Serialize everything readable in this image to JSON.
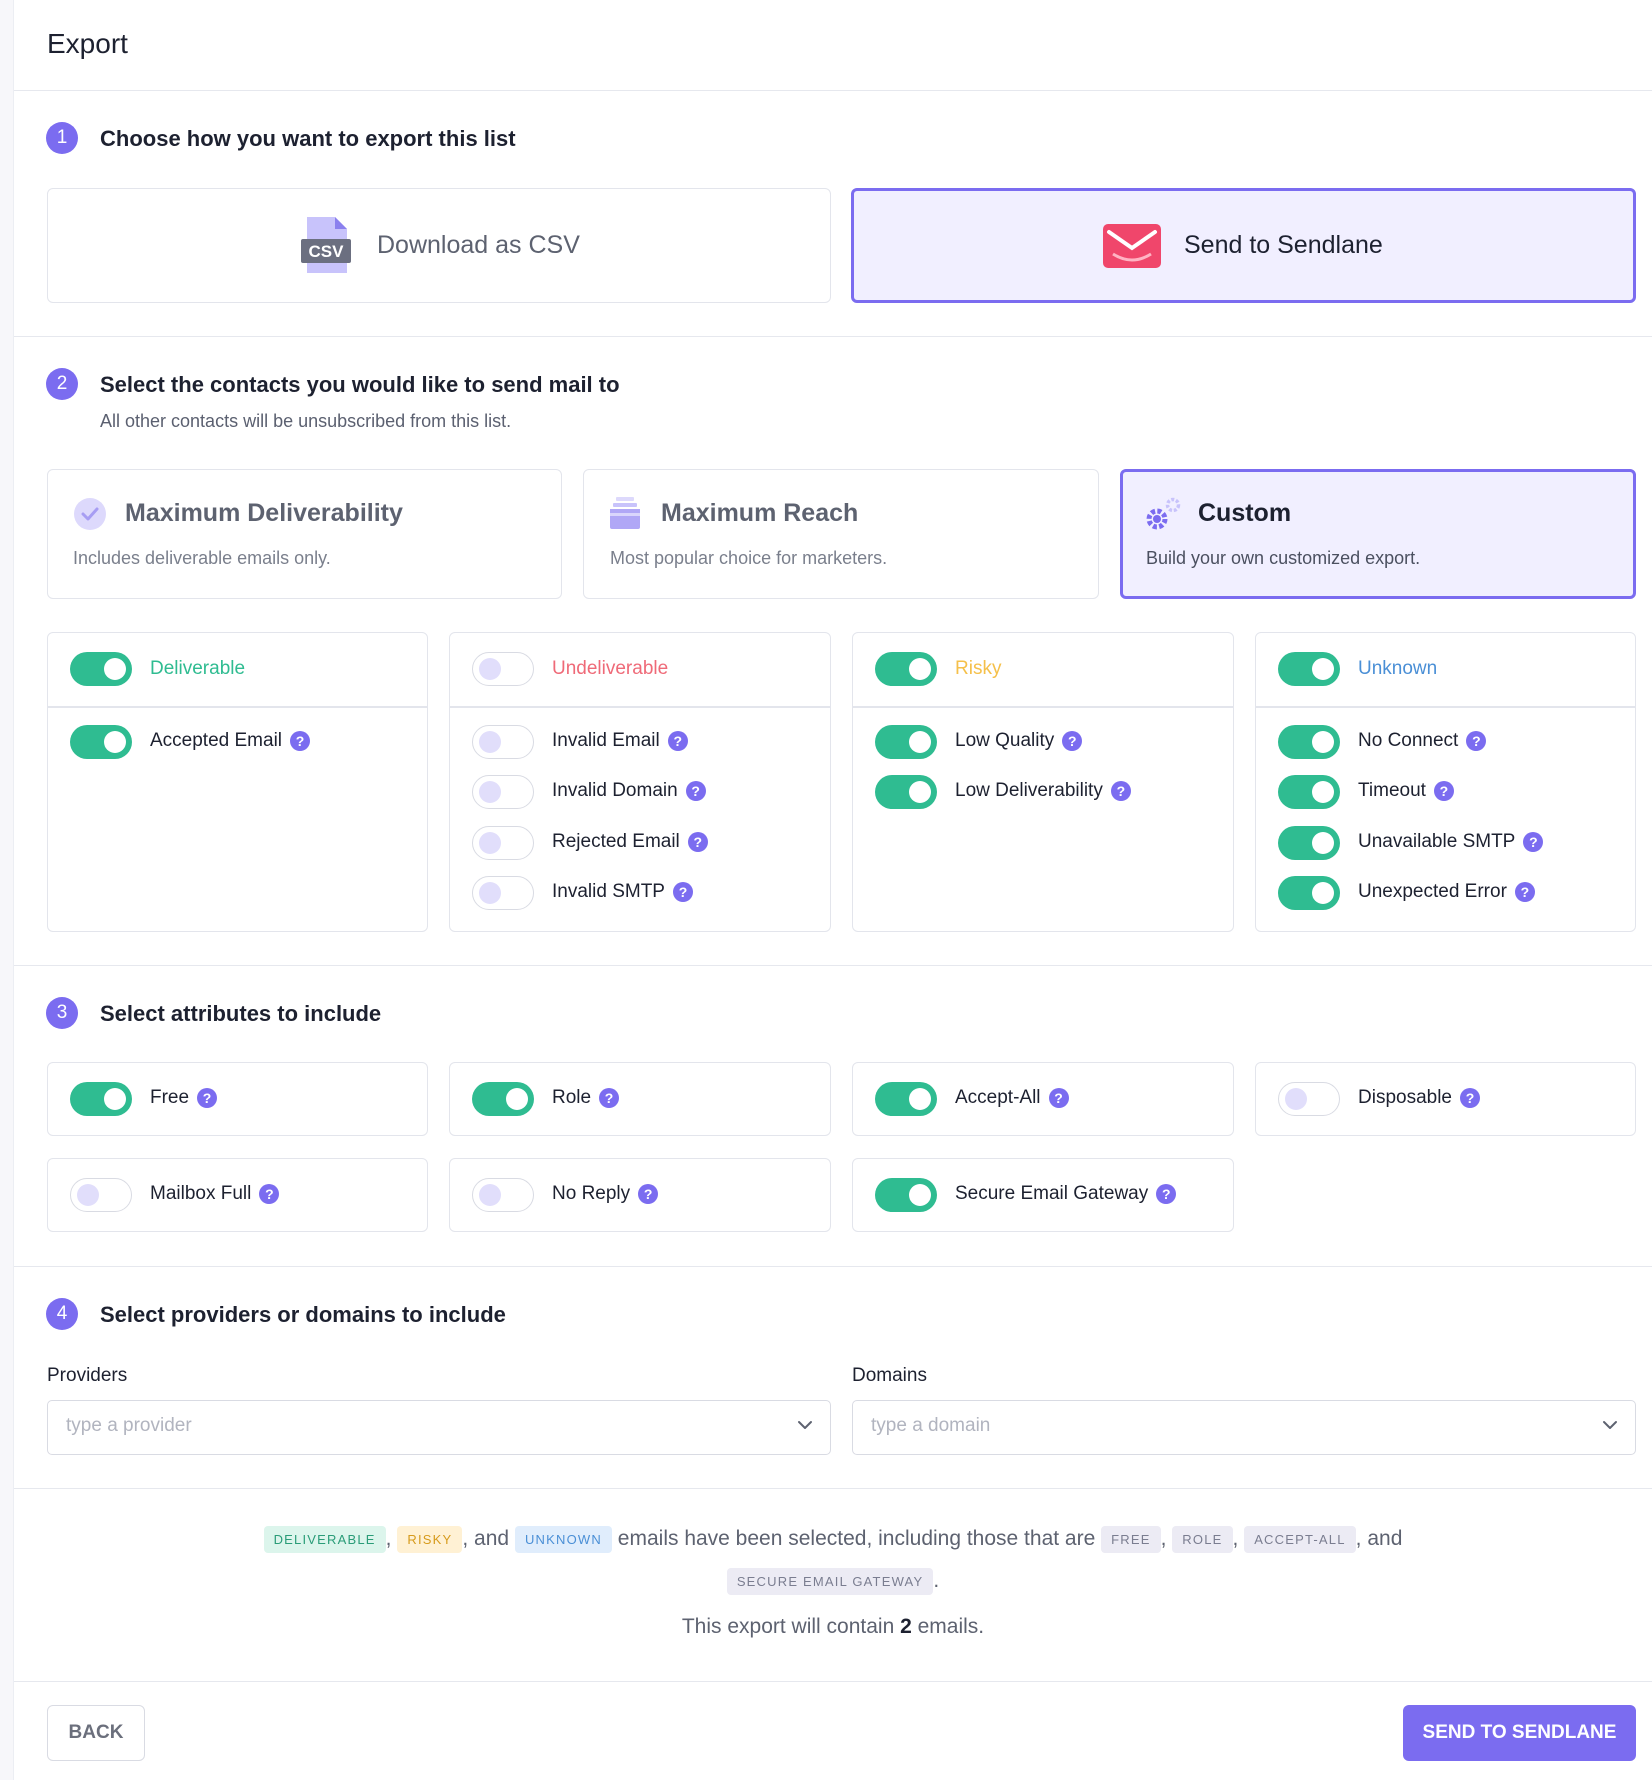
{
  "page_title": "Export",
  "step1": {
    "number": "1",
    "title": "Choose how you want to export this list",
    "options": [
      {
        "label": "Download as CSV",
        "icon": "csv-file-icon",
        "icon_text": "CSV",
        "selected": false
      },
      {
        "label": "Send to Sendlane",
        "icon": "sendlane-envelope-icon",
        "selected": true
      }
    ]
  },
  "step2": {
    "number": "2",
    "title": "Select the contacts you would like to send mail to",
    "subtitle": "All other contacts will be unsubscribed from this list.",
    "modes": [
      {
        "title": "Maximum Deliverability",
        "desc": "Includes deliverable emails only.",
        "icon": "check-circle-icon",
        "selected": false
      },
      {
        "title": "Maximum Reach",
        "desc": "Most popular choice for marketers.",
        "icon": "inbox-tray-icon",
        "selected": false
      },
      {
        "title": "Custom",
        "desc": "Build your own customized export.",
        "icon": "gears-icon",
        "selected": true
      }
    ],
    "categories": [
      {
        "name": "Deliverable",
        "color": "#2fbc91",
        "on": true,
        "items": [
          {
            "label": "Accepted Email",
            "on": true
          }
        ]
      },
      {
        "name": "Undeliverable",
        "color": "#ef6a78",
        "on": false,
        "items": [
          {
            "label": "Invalid Email",
            "on": false
          },
          {
            "label": "Invalid Domain",
            "on": false
          },
          {
            "label": "Rejected Email",
            "on": false
          },
          {
            "label": "Invalid SMTP",
            "on": false
          }
        ]
      },
      {
        "name": "Risky",
        "color": "#f5c04a",
        "on": true,
        "items": [
          {
            "label": "Low Quality",
            "on": true
          },
          {
            "label": "Low Deliverability",
            "on": true
          }
        ]
      },
      {
        "name": "Unknown",
        "color": "#4a8fd6",
        "on": true,
        "items": [
          {
            "label": "No Connect",
            "on": true
          },
          {
            "label": "Timeout",
            "on": true
          },
          {
            "label": "Unavailable SMTP",
            "on": true
          },
          {
            "label": "Unexpected Error",
            "on": true
          }
        ]
      }
    ]
  },
  "step3": {
    "number": "3",
    "title": "Select attributes to include",
    "attributes": [
      {
        "label": "Free",
        "on": true
      },
      {
        "label": "Role",
        "on": true
      },
      {
        "label": "Accept-All",
        "on": true
      },
      {
        "label": "Disposable",
        "on": false
      },
      {
        "label": "Mailbox Full",
        "on": false
      },
      {
        "label": "No Reply",
        "on": false
      },
      {
        "label": "Secure Email Gateway",
        "on": true
      }
    ]
  },
  "step4": {
    "number": "4",
    "title": "Select providers or domains to include",
    "providers_label": "Providers",
    "providers_placeholder": "type a provider",
    "domains_label": "Domains",
    "domains_placeholder": "type a domain"
  },
  "summary": {
    "tag_deliverable": "DELIVERABLE",
    "tag_risky": "RISKY",
    "tag_unknown": "UNKNOWN",
    "tag_free": "FREE",
    "tag_role": "ROLE",
    "tag_accept_all": "ACCEPT-ALL",
    "tag_seg": "SECURE EMAIL GATEWAY",
    "sep_comma": ",",
    "sep_and": ", and",
    "text_selected": "emails have been selected, including those that are",
    "text_end": ".",
    "count_prefix": "This export will contain",
    "count": "2",
    "count_suffix": "emails."
  },
  "footer": {
    "back_label": "BACK",
    "send_label": "SEND TO SENDLANE"
  },
  "colors": {
    "accent": "#7b6cf0",
    "toggle_on": "#2fbc91"
  }
}
